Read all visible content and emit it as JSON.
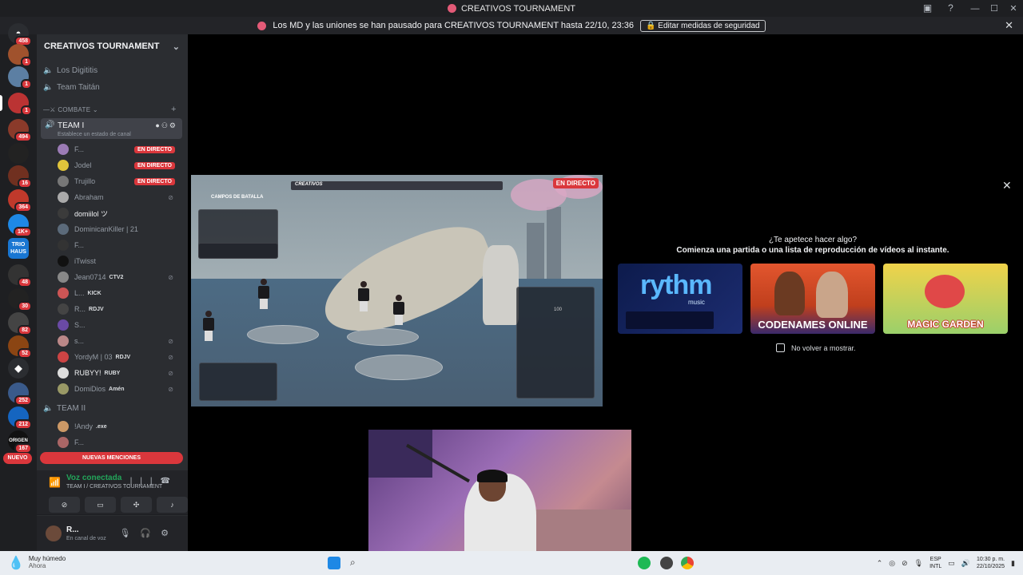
{
  "window": {
    "title": "CREATIVOS TOURNAMENT",
    "minimize": "—",
    "maximize": "☐",
    "close": "✕"
  },
  "notice": {
    "text": "Los MD y las uniones se han pausado para CREATIVOS TOURNAMENT hasta 22/10, 23:36",
    "button": "Editar medidas de seguridad",
    "close": "✕"
  },
  "rail": {
    "badges": [
      "458",
      "1",
      "1",
      "1",
      "494",
      "16",
      "364",
      "1K+",
      "48",
      "30",
      "82",
      "52",
      "252",
      "212",
      "167"
    ],
    "labels": {
      "trio": "TRIO HAUS",
      "origen": "ORIGEN"
    },
    "nuevo": "NUEVO"
  },
  "server": {
    "name": "CREATIVOS TOURNAMENT",
    "channels_top": [
      "Los Digititis",
      "Team Taitán"
    ],
    "category": "COMBATE",
    "active_channel": {
      "name": "TEAM I",
      "status": "Establece un estado de canal"
    },
    "members": [
      {
        "name": "F...",
        "live": "EN DIRECTO",
        "color": "#9b7bb5"
      },
      {
        "name": "Jodel",
        "live": "EN DIRECTO",
        "color": "#e0c43b"
      },
      {
        "name": "Trujillo",
        "live": "EN DIRECTO",
        "color": "#777"
      },
      {
        "name": "Abraham",
        "muted": true,
        "color": "#aaa"
      },
      {
        "name": "domiilol ツ",
        "bright": true,
        "color": "#3b3b3b"
      },
      {
        "name": "DominicanKiller | 21",
        "color": "#5b6a7a"
      },
      {
        "name": "F...",
        "color": "#333"
      },
      {
        "name": "iTwisst",
        "color": "#111"
      },
      {
        "name": "Jean0714",
        "tag": "CTV2",
        "muted": true,
        "color": "#888"
      },
      {
        "name": "L...",
        "tag": "KICK",
        "color": "#c55"
      },
      {
        "name": "R...",
        "tag": "RDJV",
        "color": "#444"
      },
      {
        "name": "S...",
        "color": "#6a4aa5"
      },
      {
        "name": "s...",
        "muted": true,
        "color": "#b88"
      },
      {
        "name": "YordyM | 03",
        "tag": "RDJV",
        "muted": true,
        "color": "#c44"
      },
      {
        "name": "RUBYY!",
        "tag": "RUBY",
        "muted": true,
        "bright": true,
        "color": "#ddd"
      },
      {
        "name": "DomiDios",
        "tag": "Amén",
        "muted": true,
        "color": "#996"
      }
    ],
    "team2": "TEAM II",
    "team2_members": [
      {
        "name": "!Andy",
        "tag": ".exe",
        "color": "#c96"
      },
      {
        "name": "F...",
        "color": "#a66"
      }
    ],
    "mentions": "NUEVAS MENCIONES"
  },
  "voice": {
    "title": "Voz conectada",
    "subtitle": "TEAM I / CREATIVOS TOURNAMENT"
  },
  "user": {
    "name": "R...",
    "status": "En canal de voz"
  },
  "stream": {
    "live": "EN DIRECTO",
    "hud_logo": "CREATIVOS",
    "hud_title": "CAMPOS DE BATALLA",
    "panel_value": "100"
  },
  "promo": {
    "question": "¿Te apetece hacer algo?",
    "subtitle": "Comienza una partida o una lista de reproducción de vídeos al instante.",
    "cards": {
      "rythm": "rythm",
      "rythm_sub": "music",
      "codenames": "CODENAMES ONLINE",
      "magic": "MAGIC GARDEN"
    },
    "dont_show": "No volver a mostrar."
  },
  "taskbar": {
    "weather_title": "Muy húmedo",
    "weather_sub": "Ahora",
    "lang_top": "ESP",
    "lang_bottom": "INTL",
    "time": "10:30 p. m.",
    "date": "22/10/2025"
  }
}
